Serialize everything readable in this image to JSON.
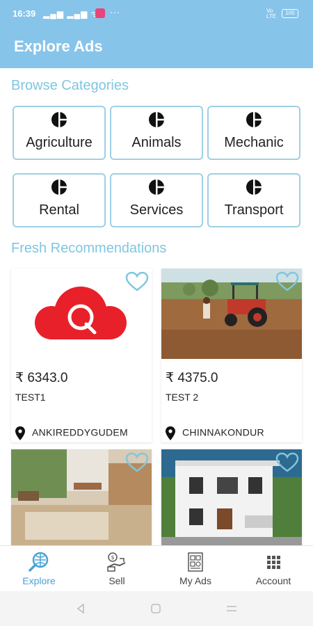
{
  "status": {
    "time": "16:39",
    "battery": "100"
  },
  "header": {
    "title": "Explore Ads"
  },
  "sections": {
    "categories_title": "Browse Categories",
    "recommendations_title": "Fresh Recommendations"
  },
  "categories": [
    {
      "label": "Agriculture"
    },
    {
      "label": "Animals"
    },
    {
      "label": "Mechanic"
    },
    {
      "label": "Rental"
    },
    {
      "label": "Services"
    },
    {
      "label": "Transport"
    }
  ],
  "ads": [
    {
      "price": "₹ 6343.0",
      "title": "TEST1",
      "location": "ANKIREDDYGUDEM",
      "image": "q-cloud-logo"
    },
    {
      "price": "₹ 4375.0",
      "title": "TEST 2",
      "location": "CHINNAKONDUR",
      "image": "tractor-photo"
    },
    {
      "image": "interior-photo"
    },
    {
      "image": "house-photo"
    }
  ],
  "nav": [
    {
      "label": "Explore",
      "icon": "explore-icon",
      "active": true
    },
    {
      "label": "Sell",
      "icon": "sell-icon"
    },
    {
      "label": "My Ads",
      "icon": "my-ads-icon"
    },
    {
      "label": "Account",
      "icon": "account-icon"
    }
  ],
  "colors": {
    "primary": "#87c4ea",
    "accent": "#7fc6e0",
    "active_nav": "#4aa3d6",
    "logo_red": "#e8202a"
  }
}
